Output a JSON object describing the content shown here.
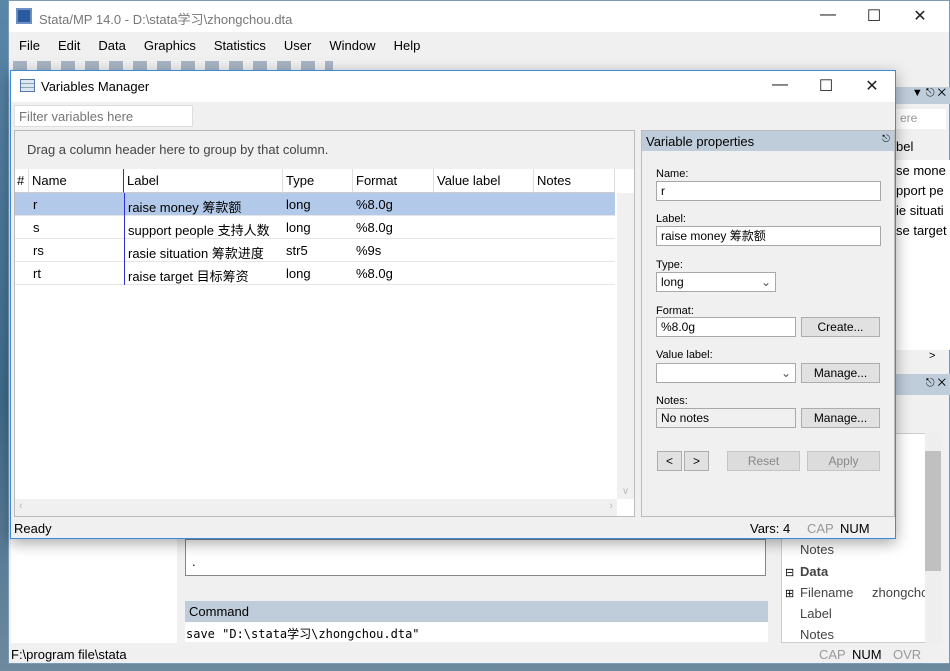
{
  "app": {
    "title": "Stata/MP 14.0 - D:\\stata学习\\zhongchou.dta",
    "menu": [
      "File",
      "Edit",
      "Data",
      "Graphics",
      "Statistics",
      "User",
      "Window",
      "Help"
    ],
    "status_path": "F:\\program file\\stata",
    "status": {
      "cap": "CAP",
      "num": "NUM",
      "ovr": "OVR"
    }
  },
  "behind": {
    "var_filter_placeholder": "ere",
    "var_col": "bel",
    "var_rows": [
      "se mone",
      "pport pe",
      "ie situati",
      "se target"
    ],
    "props_rows": [
      "Notes"
    ],
    "data_section": "Data",
    "data_rows": [
      {
        "k": "Filename",
        "v": "zhongchou"
      },
      {
        "k": "Label",
        "v": ""
      },
      {
        "k": "Notes",
        "v": ""
      }
    ],
    "results_prompt": ".",
    "command_header": "Command",
    "command_text": "save \"D:\\stata学习\\zhongchou.dta\""
  },
  "dialog": {
    "title": "Variables Manager",
    "filter_placeholder": "Filter variables here",
    "group_hint": "Drag a column header here to group by that column.",
    "columns": [
      "#",
      "Name",
      "Label",
      "Type",
      "Format",
      "Value label",
      "Notes"
    ],
    "rows": [
      {
        "name": "r",
        "label": "raise money 筹款额",
        "type": "long",
        "format": "%8.0g",
        "selected": true
      },
      {
        "name": "s",
        "label": "support people 支持人数",
        "type": "long",
        "format": "%8.0g"
      },
      {
        "name": "rs",
        "label": "rasie situation 筹款进度",
        "type": "str5",
        "format": "%9s"
      },
      {
        "name": "rt",
        "label": "raise target 目标筹资",
        "type": "long",
        "format": "%8.0g"
      }
    ],
    "status": "Ready",
    "vars": "Vars: 4",
    "cap": "CAP",
    "num": "NUM",
    "props": {
      "header": "Variable properties",
      "name_label": "Name:",
      "name_value": "r",
      "label_label": "Label:",
      "label_value": "raise money 筹款额",
      "type_label": "Type:",
      "type_value": "long",
      "format_label": "Format:",
      "format_value": "%8.0g",
      "create": "Create...",
      "vlabel_label": "Value label:",
      "vlabel_value": "",
      "manage1": "Manage...",
      "notes_label": "Notes:",
      "notes_value": "No notes",
      "manage2": "Manage...",
      "prev": "<",
      "next": ">",
      "reset": "Reset",
      "apply": "Apply"
    }
  }
}
